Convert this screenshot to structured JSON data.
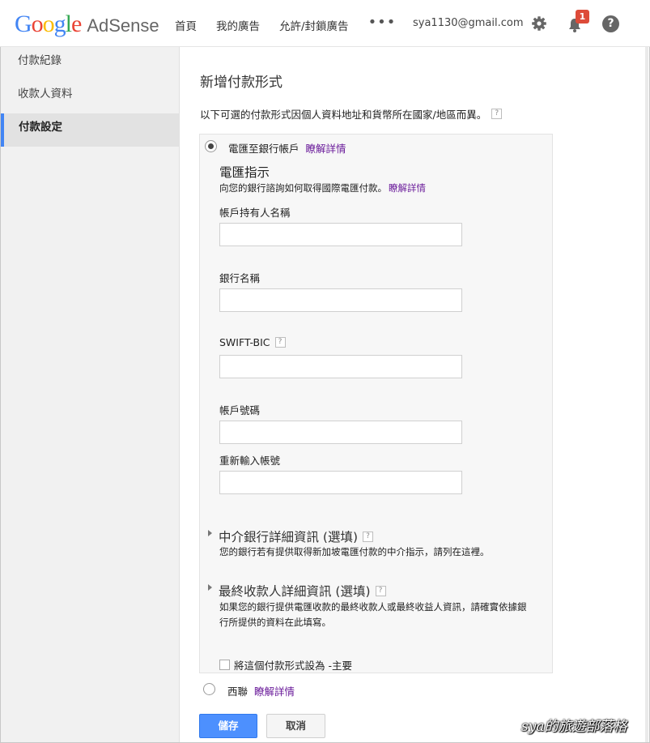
{
  "header": {
    "logo_google": [
      "G",
      "o",
      "o",
      "g",
      "l",
      "e"
    ],
    "logo_product": "AdSense",
    "nav": [
      "首頁",
      "我的廣告",
      "允許/封鎖廣告"
    ],
    "more": "•••",
    "account_email": "sya1130@gmail.com",
    "notification_count": "1",
    "help_symbol": "?"
  },
  "sidebar": {
    "items": [
      {
        "label": "付款紀錄"
      },
      {
        "label": "收款人資料"
      },
      {
        "label": "付款設定"
      }
    ]
  },
  "main": {
    "title": "新增付款形式",
    "intro": "以下可選的付款形式因個人資料地址和貨幣所在國家/地區而異。",
    "help_symbol": "?",
    "wire": {
      "option_label": "電匯至銀行帳戶",
      "learn_more": "瞭解詳情",
      "section_title": "電匯指示",
      "section_desc": "向您的銀行諮詢如何取得國際電匯付款。",
      "section_link": "瞭解詳情",
      "fields": {
        "account_holder": "帳戶持有人名稱",
        "bank_name": "銀行名稱",
        "swift": "SWIFT-BIC",
        "account_number": "帳戶號碼",
        "account_number_confirm": "重新輸入帳號"
      },
      "intermediary_title": "中介銀行詳細資訊 (選填)",
      "intermediary_desc": "您的銀行若有提供取得新加坡電匯付款的中介指示，請列在這裡。",
      "beneficiary_title": "最終收款人詳細資訊 (選填)",
      "beneficiary_desc": "如果您的銀行提供電匯收款的最終收款人或最終收益人資訊，請確實依據銀行所提供的資料在此填寫。",
      "primary_checkbox": "將這個付款形式設為 -主要"
    },
    "western_union": {
      "option_label": "西聯",
      "learn_more": "瞭解詳情"
    },
    "save_label": "儲存",
    "cancel_label": "取消"
  },
  "watermark": "sya的旅遊部落格",
  "colors": {
    "primary_button": "#4d90fe",
    "link": "#6a1b9a",
    "sidebar_active_border": "#4285f4",
    "badge": "#dd4b39"
  }
}
